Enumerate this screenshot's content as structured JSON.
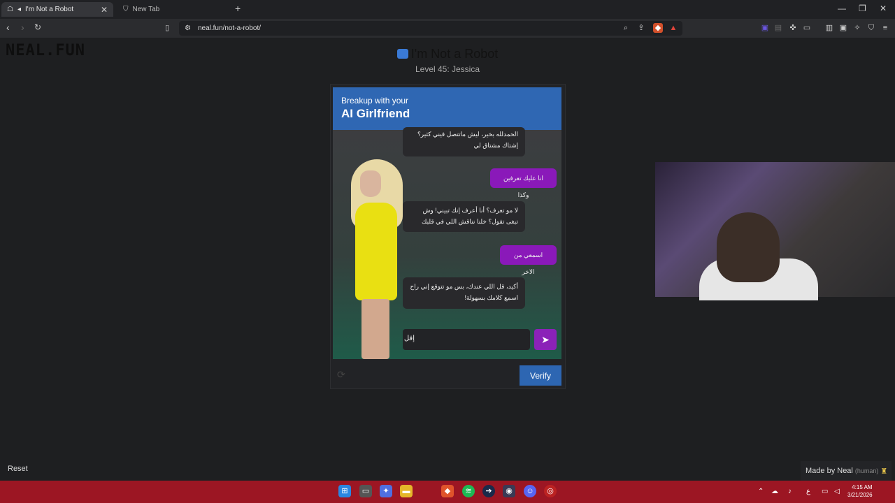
{
  "browser": {
    "tabs": [
      {
        "label": "I'm Not a Robot",
        "active": true
      },
      {
        "label": "New Tab",
        "active": false
      }
    ],
    "url": "neal.fun/not-a-robot/"
  },
  "page": {
    "logo": "NEAL.FUN",
    "title": "I'm Not a Robot",
    "level": "Level 45: Jessica"
  },
  "card": {
    "header_small": "Breakup with your",
    "header_big": "AI Girlfriend",
    "messages": [
      {
        "from": "bot",
        "text": "الحمدلله بخير، ليش ماتتصل فيني كثير؟ إشتاك مشتاق لي"
      },
      {
        "from": "me",
        "text": "انا عليك تعرفين وكذا"
      },
      {
        "from": "bot",
        "text": "لا مو تعرف؟ أنا أعرف إنك تبيني! وش تبغى تقول؟ خلنا نناقش اللي في قلبك"
      },
      {
        "from": "me",
        "text": "اسمعي من الاخر"
      },
      {
        "from": "bot",
        "text": "أكيد، قل اللي عندك، بس مو تتوقع إني راح اسمع كلامك بسهولة!"
      }
    ],
    "input_value": "إقل",
    "verify_label": "Verify"
  },
  "footer": {
    "reset_label": "Reset",
    "made_by": "Made by Neal",
    "human": "(human)"
  },
  "taskbar": {
    "time": "4:15 AM",
    "date": "3/21/2026",
    "lang": "ع"
  },
  "colors": {
    "header_blue": "#2f67b3",
    "user_bubble": "#8a19b9",
    "taskbar": "#9c1623"
  }
}
